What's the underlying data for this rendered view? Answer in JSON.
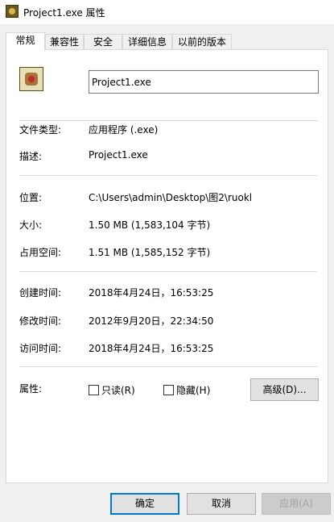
{
  "window": {
    "title": "Project1.exe 属性"
  },
  "tabs": [
    {
      "label": "常规",
      "active": true
    },
    {
      "label": "兼容性"
    },
    {
      "label": "安全"
    },
    {
      "label": "详细信息"
    },
    {
      "label": "以前的版本"
    }
  ],
  "general": {
    "file_name": "Project1.exe",
    "file_type_label": "文件类型:",
    "file_type_value": "应用程序 (.exe)",
    "description_label": "描述:",
    "description_value": "Project1.exe",
    "location_label": "位置:",
    "location_value": "C:\\Users\\admin\\Desktop\\图2\\ruokl",
    "size_label": "大小:",
    "size_value": "1.50 MB (1,583,104 字节)",
    "size_on_disk_label": "占用空间:",
    "size_on_disk_value": "1.51 MB (1,585,152 字节)",
    "created_label": "创建时间:",
    "created_value": "2018年4月24日，16:53:25",
    "modified_label": "修改时间:",
    "modified_value": "2012年9月20日，22:34:50",
    "accessed_label": "访问时间:",
    "accessed_value": "2018年4月24日，16:53:25",
    "attributes_label": "属性:",
    "readonly_label": "只读(R)",
    "readonly_checked": false,
    "hidden_label": "隐藏(H)",
    "hidden_checked": false,
    "advanced_label": "高级(D)..."
  },
  "buttons": {
    "ok": "确定",
    "cancel": "取消",
    "apply": "应用(A)"
  },
  "icons": {
    "app": "project1-app-icon",
    "file": "project1-file-icon"
  }
}
